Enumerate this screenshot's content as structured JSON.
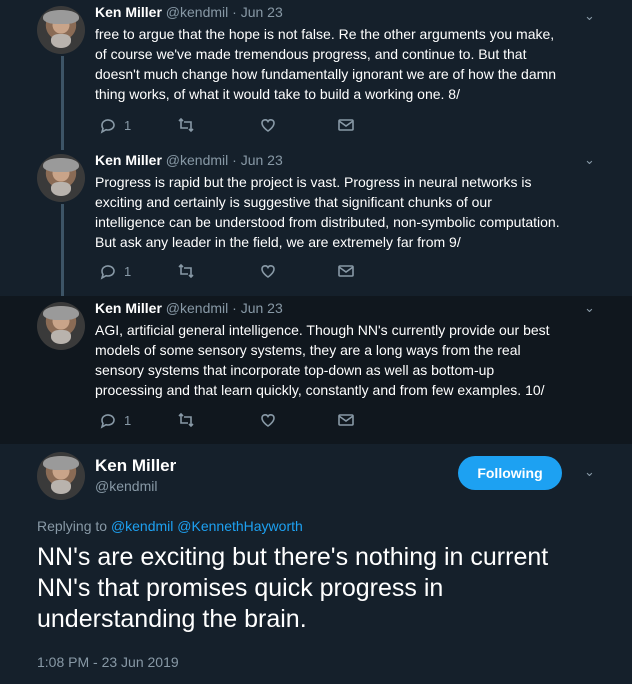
{
  "tweets": [
    {
      "name": "Ken Miller",
      "handle": "@kendmil",
      "date": "· Jun 23",
      "text": "free to argue that the hope is not false. Re the other arguments you make, of course we've made tremendous progress, and continue to. But that doesn't much change how fundamentally ignorant we are of how the damn thing works, of what it would take to build a working one. 8/",
      "replies": "1"
    },
    {
      "name": "Ken Miller",
      "handle": "@kendmil",
      "date": "· Jun 23",
      "text": "Progress is rapid but the project is vast. Progress in neural networks is exciting and certainly is suggestive that significant chunks of our intelligence can be understood from distributed, non-symbolic computation. But ask any leader in the field, we are extremely far from 9/",
      "replies": "1"
    },
    {
      "name": "Ken Miller",
      "handle": "@kendmil",
      "date": "· Jun 23",
      "text": "AGI, artificial general intelligence. Though NN's currently provide our best models of some sensory systems, they are a long ways from the real sensory systems that incorporate top-down as well as bottom-up processing and that learn quickly, constantly and from few examples. 10/",
      "replies": "1"
    }
  ],
  "main": {
    "name": "Ken Miller",
    "handle": "@kendmil",
    "follow_label": "Following",
    "replying_prefix": "Replying to",
    "replying_to_1": "@kendmil",
    "replying_to_2": "@KennethHayworth",
    "text": "NN's are exciting but there's nothing in current NN's that promises quick progress in understanding the brain.",
    "timestamp": "1:08 PM - 23 Jun 2019"
  },
  "colors": {
    "background": "#15202b",
    "accent": "#1da1f2",
    "muted": "#8899a6"
  }
}
